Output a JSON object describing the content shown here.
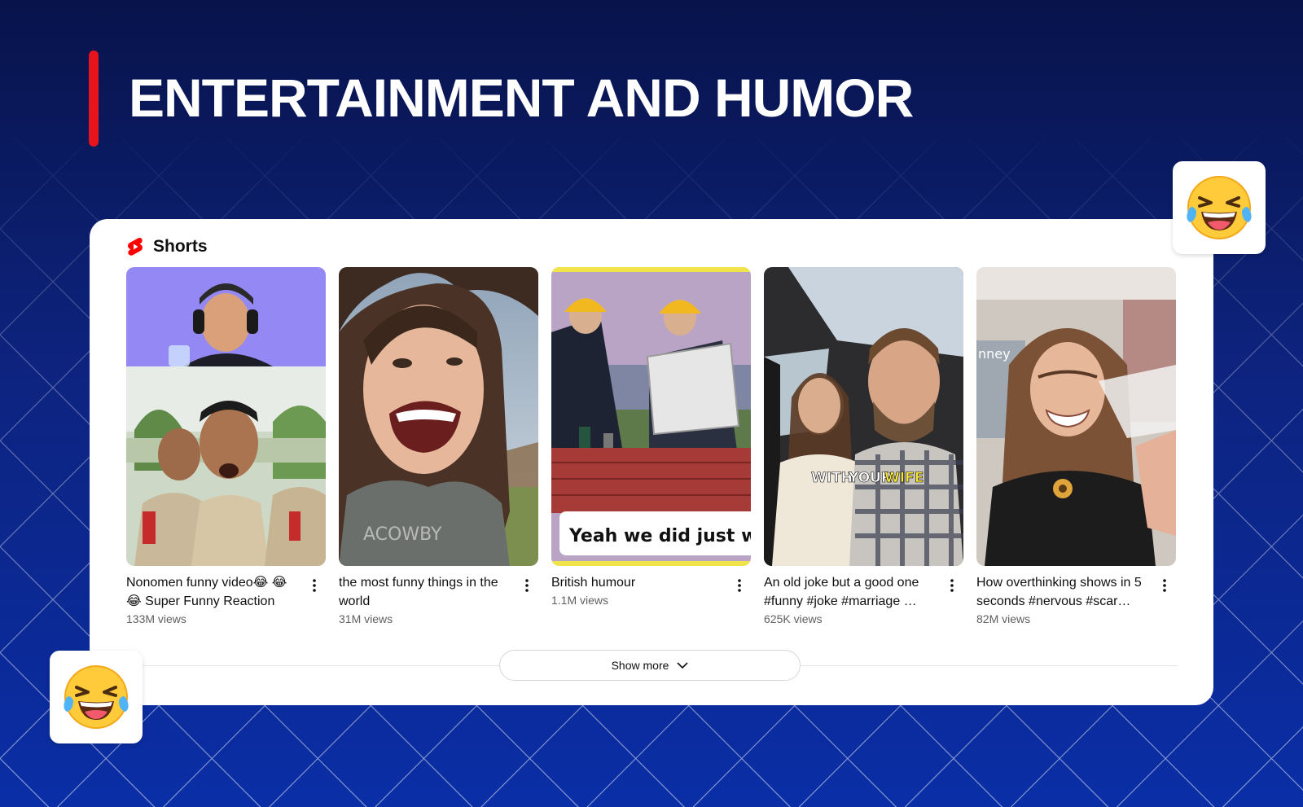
{
  "page": {
    "title": "ENTERTAINMENT AND HUMOR",
    "accent_color": "#e8141c"
  },
  "decor": {
    "top_emoji": "laughing-crying-emoji-icon",
    "bottom_emoji": "laughing-crying-emoji-icon"
  },
  "shorts": {
    "section_label": "Shorts",
    "icon": "youtube-shorts-icon",
    "videos": [
      {
        "title": "Nonomen funny video😂 😂 😂 Super Funny Reaction",
        "views": "133M views"
      },
      {
        "title": "the most funny things in the world",
        "views": "31M views"
      },
      {
        "title": "British humour",
        "views": "1.1M views",
        "caption": "Yeah we did just what it"
      },
      {
        "title": "An old joke but a good one #funny #joke #marriage …",
        "views": "625K views",
        "caption_a": "WITH",
        "caption_b": "YOUR",
        "caption_c": "WIFE"
      },
      {
        "title": "How overthinking shows in 5 seconds #nervous #scar…",
        "views": "82M views",
        "sign": "nney"
      }
    ],
    "show_more_label": "Show more"
  }
}
